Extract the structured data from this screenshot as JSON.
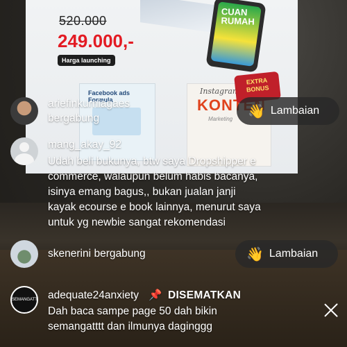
{
  "poster": {
    "old_price": "520.000",
    "new_price": "249.000,-",
    "launch_badge": "Harga launching",
    "phone_text": "CUAN RUMAH",
    "fb_book_title": "Facebook ads Formula",
    "ig_book_title_1": "Instagram",
    "ig_book_title_2": "KONTEN",
    "ig_book_title_3": "Marketing",
    "extra_bonus": "EXTRA BONUS"
  },
  "comments": [
    {
      "username": "ariefinkurniagaes",
      "text": "bergabung",
      "action": "Lambaian",
      "avatar_icon": "profile-photo"
    },
    {
      "username": "mang_akay_92",
      "text_lines": [
        "Udah beli bukunya, btw saya Dropshipper e",
        "commerce, walaupun belum habis bacanya,",
        "isinya emang bagus,, bukan jualan janji",
        "kayak ecourse e book lainnya, menurut saya",
        "untuk yg newbie sangat rekomendasi"
      ],
      "avatar_icon": "default-avatar"
    },
    {
      "username": "skenerini",
      "text": "bergabung",
      "action": "Lambaian",
      "avatar_icon": "profile-photo"
    }
  ],
  "pinned": {
    "username": "adequate24anxiety",
    "pin_icon": "📌",
    "pin_label": "DISEMATKAN",
    "avatar_text": "SEMANGATTTT",
    "text_lines": [
      "Dah baca sampe page 50 dah bikin",
      "semangatttt dan ilmunya daginggg"
    ]
  },
  "icons": {
    "wave": "👋"
  }
}
